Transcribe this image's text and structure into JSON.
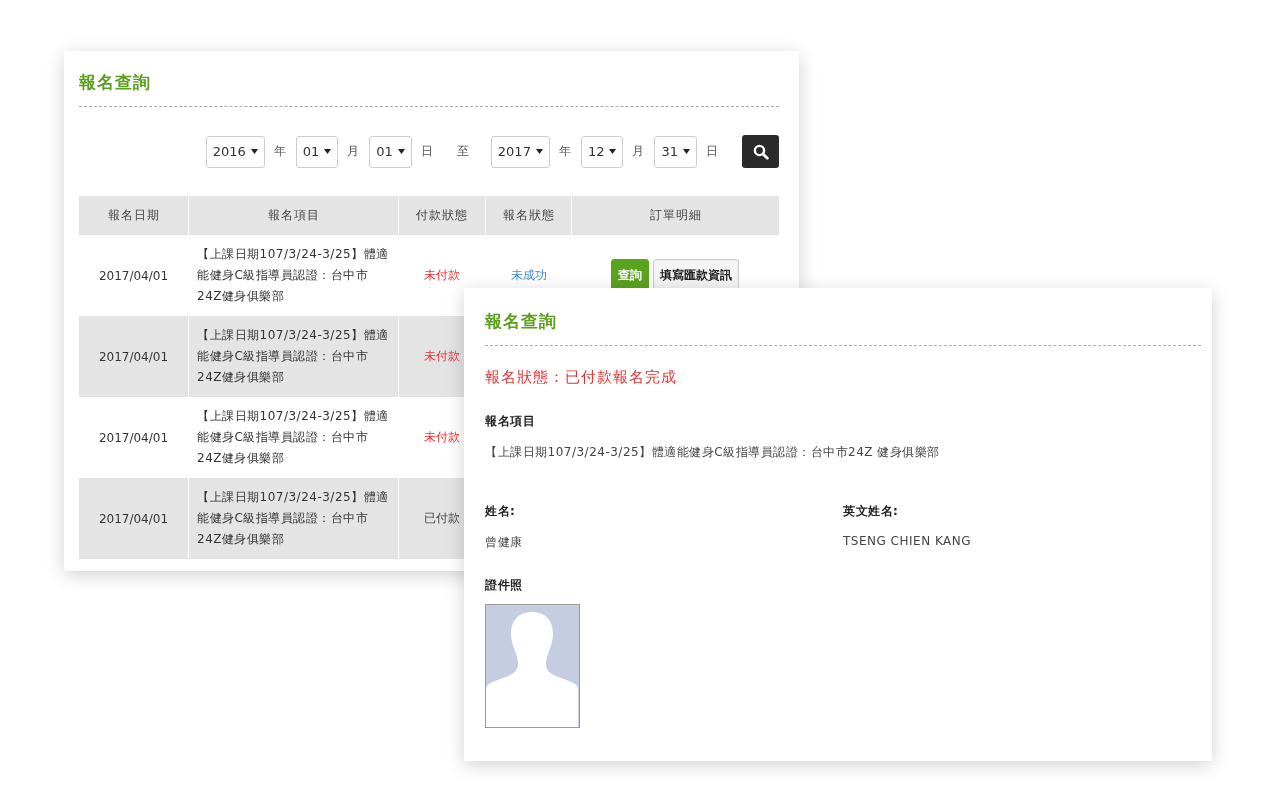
{
  "query_panel": {
    "title": "報名查詢",
    "date_range": [
      {
        "value": "2016",
        "unit": "年"
      },
      {
        "value": "01",
        "unit": "月"
      },
      {
        "value": "01",
        "unit": "日"
      },
      {
        "separator": "至"
      },
      {
        "value": "2017",
        "unit": "年"
      },
      {
        "value": "12",
        "unit": "月"
      },
      {
        "value": "31",
        "unit": "日"
      }
    ],
    "table": {
      "columns": [
        "報名日期",
        "報名項目",
        "付款狀態",
        "報名狀態",
        "訂單明細"
      ],
      "rows": [
        {
          "date": "2017/04/01",
          "item": "【上課日期107/3/24-3/25】體適能健身C級指導員認證：台中市24Z健身俱樂部",
          "payment": "未付款",
          "paid": false,
          "status": "未成功",
          "buttons": [
            {
              "label": "查詢",
              "primary": true
            },
            {
              "label": "填寫匯款資訊",
              "primary": false
            }
          ]
        },
        {
          "date": "2017/04/01",
          "item": "【上課日期107/3/24-3/25】體適能健身C級指導員認證：台中市24Z健身俱樂部",
          "payment": "未付款",
          "paid": false
        },
        {
          "date": "2017/04/01",
          "item": "【上課日期107/3/24-3/25】體適能健身C級指導員認證：台中市24Z健身俱樂部",
          "payment": "未付款",
          "paid": false
        },
        {
          "date": "2017/04/01",
          "item": "【上課日期107/3/24-3/25】體適能健身C級指導員認證：台中市24Z健身俱樂部",
          "payment": "已付款",
          "paid": true
        }
      ]
    }
  },
  "detail_panel": {
    "title": "報名查詢",
    "status": "報名狀態：已付款報名完成",
    "item_label": "報名項目",
    "item": "【上課日期107/3/24-3/25】體適能健身C級指導員認證：台中市24Z 健身俱樂部",
    "fields": [
      {
        "label": "姓名:",
        "value": "曾健康"
      },
      {
        "label": "英文姓名:",
        "value": "TSENG CHIEN KANG"
      }
    ],
    "photo_label": "證件照"
  }
}
